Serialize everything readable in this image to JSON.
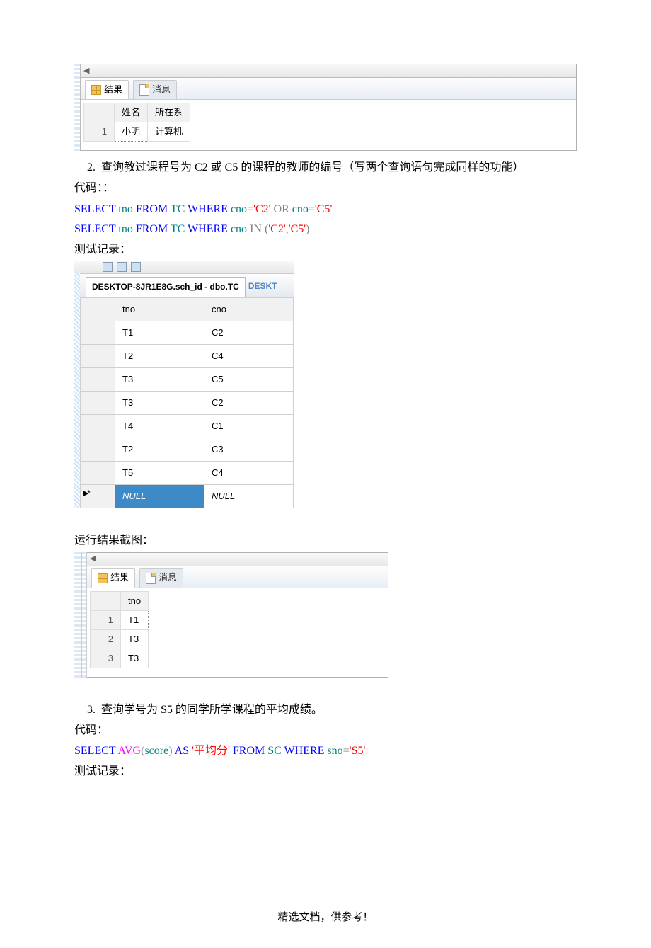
{
  "panel1": {
    "tab_results": "结果",
    "tab_messages": "消息",
    "columns": [
      "姓名",
      "所在系"
    ],
    "rows": [
      {
        "n": "1",
        "name": "小明",
        "dept": "计算机"
      }
    ]
  },
  "q2": {
    "num": "2.",
    "text": "查询教过课程号为 C2 或 C5 的课程的教师的编号（写两个查询语句完成同样的功能）",
    "code_label": "代码：：",
    "sql1": {
      "s": "SELECT",
      "c1": "tno",
      "f": "FROM",
      "t": "TC",
      "w": "WHERE",
      "c2": "cno",
      "eq": "=",
      "v1": "'C2'",
      "or": "OR",
      "c3": "cno",
      "eq2": "=",
      "v2": "'C5'"
    },
    "sql2": {
      "s": "SELECT",
      "c1": "tno",
      "f": "FROM",
      "t": "TC",
      "w": "WHERE",
      "c2": "cno",
      "in": "IN",
      "p": "(",
      "v1": "'C2'",
      "comma": ",",
      "v2": "'C5'",
      "p2": ")"
    },
    "test_label": "测试记录：",
    "tc_tab": "DESKTOP-8JR1E8G.sch_id - dbo.TC",
    "tc_tab_after": "DESKT",
    "tc_cols": [
      "tno",
      "cno"
    ],
    "tc_rows": [
      [
        "T1",
        "C2"
      ],
      [
        "T2",
        "C4"
      ],
      [
        "T3",
        "C5"
      ],
      [
        "T3",
        "C2"
      ],
      [
        "T4",
        "C1"
      ],
      [
        "T2",
        "C3"
      ],
      [
        "T5",
        "C4"
      ]
    ],
    "tc_null": "NULL",
    "run_label": "运行结果截图：",
    "result_cols": [
      "tno"
    ],
    "result_rows": [
      {
        "n": "1",
        "v": "T1"
      },
      {
        "n": "2",
        "v": "T3"
      },
      {
        "n": "3",
        "v": "T3"
      }
    ]
  },
  "q3": {
    "num": "3.",
    "text": "查询学号为 S5 的同学所学课程的平均成绩。",
    "code_label": "代码：",
    "sql": {
      "s": "SELECT",
      "avg": "AVG",
      "p1": "(",
      "col": "score",
      "p2": ")",
      "as": "AS",
      "alias": "'平均分'",
      "f": "FROM",
      "t": "SC",
      "w": "WHERE",
      "c": "sno",
      "eq": "=",
      "v": "'S5'"
    },
    "test_label": "测试记录："
  },
  "footer": "精选文档，供参考！"
}
